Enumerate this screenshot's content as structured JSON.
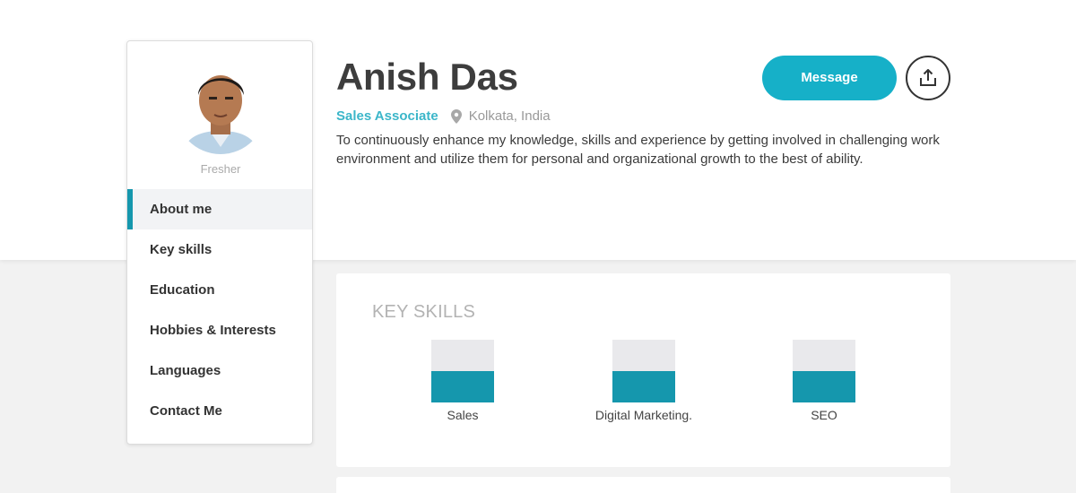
{
  "profile": {
    "status": "Fresher"
  },
  "nav": {
    "items": [
      {
        "label": "About me",
        "active": true
      },
      {
        "label": "Key skills"
      },
      {
        "label": "Education"
      },
      {
        "label": "Hobbies & Interests"
      },
      {
        "label": "Languages"
      },
      {
        "label": "Contact Me"
      }
    ]
  },
  "header": {
    "name": "Anish Das",
    "role": "Sales Associate",
    "location": "Kolkata, India",
    "location_icon": "map-pin-icon",
    "summary": "To continuously enhance my knowledge, skills and experience by getting involved in challenging work environment and utilize them for personal and organizational growth to the best of ability."
  },
  "actions": {
    "message_label": "Message",
    "share_icon": "share-icon"
  },
  "skills": {
    "title": "KEY SKILLS",
    "items": [
      {
        "label": "Sales",
        "level": 0.5
      },
      {
        "label": "Digital Marketing.",
        "level": 0.5
      },
      {
        "label": "SEO",
        "level": 0.5
      }
    ]
  },
  "colors": {
    "accent": "#16b0c8",
    "accent_dark": "#1597ad",
    "role_text": "#3bb6c9"
  }
}
